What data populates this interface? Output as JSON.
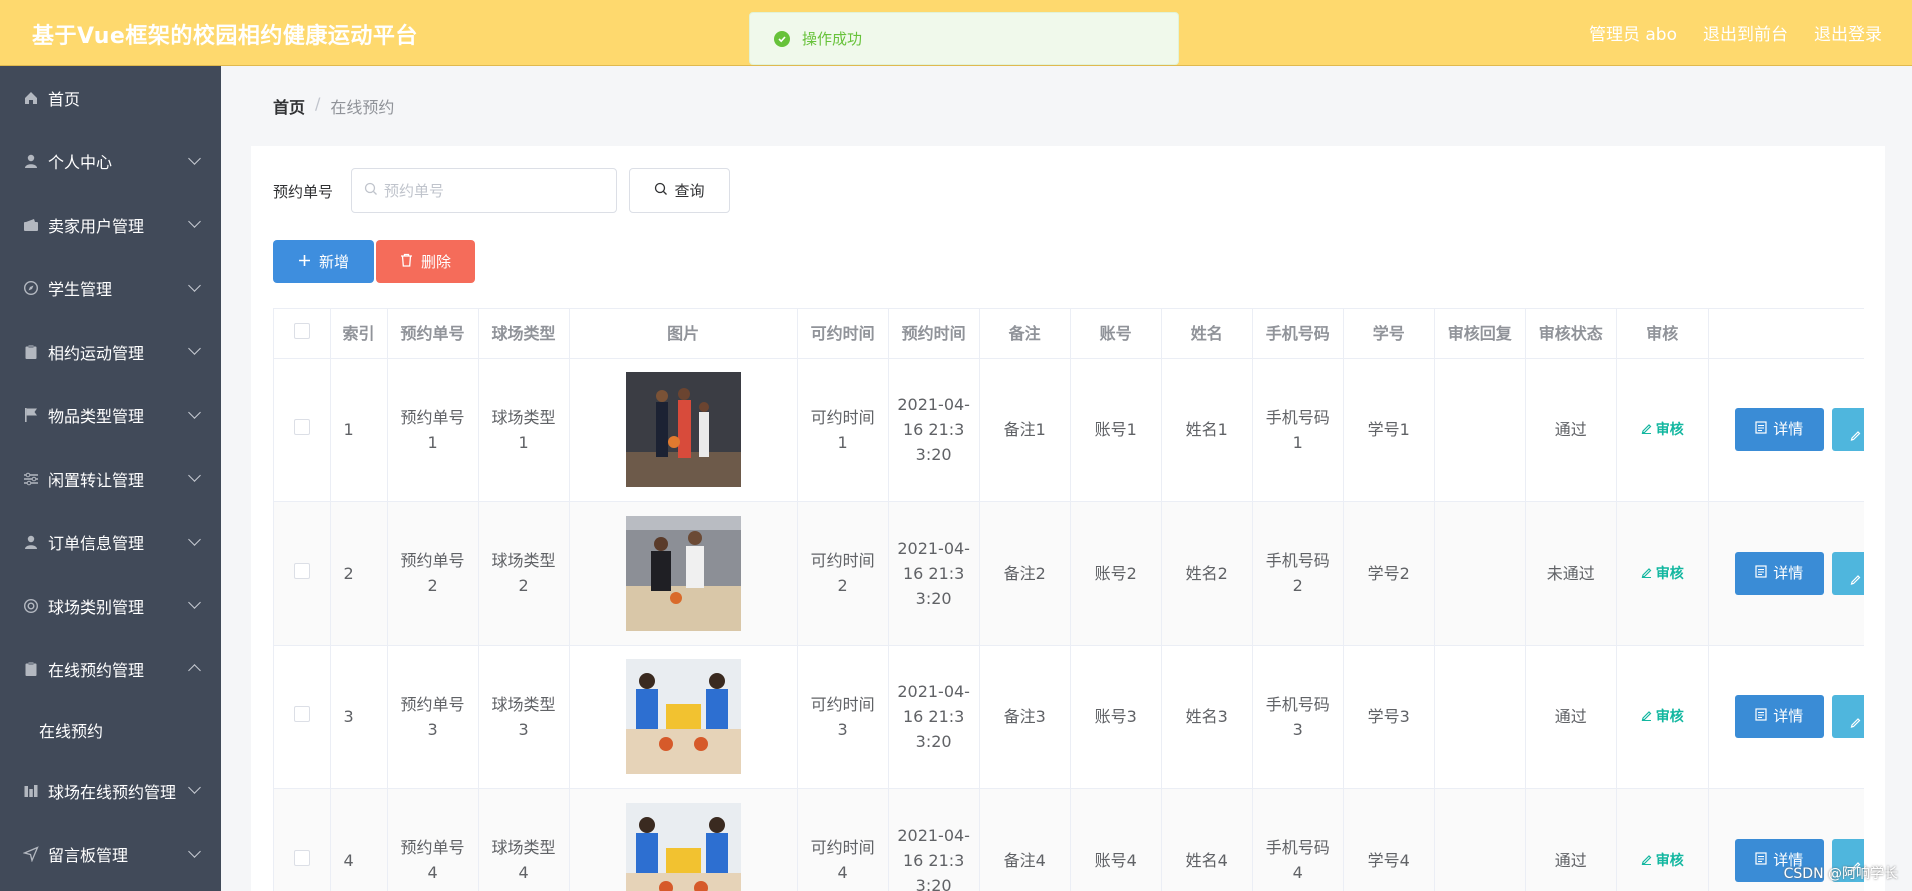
{
  "header": {
    "title": "基于Vue框架的校园相约健康运动平台",
    "user_label": "管理员 abo",
    "to_frontend": "退出到前台",
    "logout": "退出登录"
  },
  "toast": {
    "message": "操作成功",
    "color": "#67c23a"
  },
  "sidebar": {
    "items": [
      {
        "label": "首页",
        "icon": "home-icon",
        "expandable": false
      },
      {
        "label": "个人中心",
        "icon": "user-icon",
        "expandable": true
      },
      {
        "label": "卖家用户管理",
        "icon": "wallet-icon",
        "expandable": true
      },
      {
        "label": "学生管理",
        "icon": "compass-icon",
        "expandable": true
      },
      {
        "label": "相约运动管理",
        "icon": "clipboard-icon",
        "expandable": true
      },
      {
        "label": "物品类型管理",
        "icon": "flag-icon",
        "expandable": true
      },
      {
        "label": "闲置转让管理",
        "icon": "sliders-icon",
        "expandable": true
      },
      {
        "label": "订单信息管理",
        "icon": "user-icon",
        "expandable": true
      },
      {
        "label": "球场类别管理",
        "icon": "lifebuoy-icon",
        "expandable": true
      },
      {
        "label": "在线预约管理",
        "icon": "clipboard-icon",
        "expandable": true,
        "expanded": true
      }
    ],
    "sub_item": "在线预约",
    "items_after": [
      {
        "label": "球场在线预约管理",
        "icon": "chart-icon",
        "expandable": true
      },
      {
        "label": "留言板管理",
        "icon": "send-icon",
        "expandable": true
      }
    ]
  },
  "breadcrumb": {
    "home": "首页",
    "separator": "/",
    "current": "在线预约"
  },
  "search": {
    "label": "预约单号",
    "placeholder": "预约单号",
    "value": "",
    "query_label": "查询"
  },
  "actions": {
    "add_label": "新增",
    "delete_label": "删除"
  },
  "table": {
    "headers": [
      "",
      "索引",
      "预约单号",
      "球场类型",
      "图片",
      "可约时间",
      "预约时间",
      "备注",
      "账号",
      "姓名",
      "手机号码",
      "学号",
      "审核回复",
      "审核状态",
      "审核",
      ""
    ],
    "rows": [
      {
        "index": "1",
        "order_no": "预约单号1",
        "court_type": "球场类型1",
        "avail_time": "可约时间1",
        "book_time": "2021-04-16 21:33:20",
        "note": "备注1",
        "account": "账号1",
        "name": "姓名1",
        "phone": "手机号码1",
        "student_no": "学号1",
        "reply": "",
        "status": "通过",
        "audit": "审核",
        "detail": "详情",
        "photo": "basketball-players-photo"
      },
      {
        "index": "2",
        "order_no": "预约单号2",
        "court_type": "球场类型2",
        "avail_time": "可约时间2",
        "book_time": "2021-04-16 21:33:20",
        "note": "备注2",
        "account": "账号2",
        "name": "姓名2",
        "phone": "手机号码2",
        "student_no": "学号2",
        "reply": "",
        "status": "未通过",
        "audit": "审核",
        "detail": "详情",
        "photo": "basketball-dribble-photo"
      },
      {
        "index": "3",
        "order_no": "预约单号3",
        "court_type": "球场类型3",
        "avail_time": "可约时间3",
        "book_time": "2021-04-16 21:33:20",
        "note": "备注3",
        "account": "账号3",
        "name": "姓名3",
        "phone": "手机号码3",
        "student_no": "学号3",
        "reply": "",
        "status": "通过",
        "audit": "审核",
        "detail": "详情",
        "photo": "kids-basketball-photo"
      },
      {
        "index": "4",
        "order_no": "预约单号4",
        "court_type": "球场类型4",
        "avail_time": "可约时间4",
        "book_time": "2021-04-16 21:33:20",
        "note": "备注4",
        "account": "账号4",
        "name": "姓名4",
        "phone": "手机号码4",
        "student_no": "学号4",
        "reply": "",
        "status": "通过",
        "audit": "审核",
        "detail": "详情",
        "photo": "kids-basketball-photo"
      }
    ]
  },
  "watermark": "CSDN @阿响学长",
  "colors": {
    "header_bg": "#fed96e",
    "sidebar_bg": "#414a59",
    "primary": "#3e8ede",
    "danger": "#f56c5a",
    "audit": "#13b7a0"
  }
}
